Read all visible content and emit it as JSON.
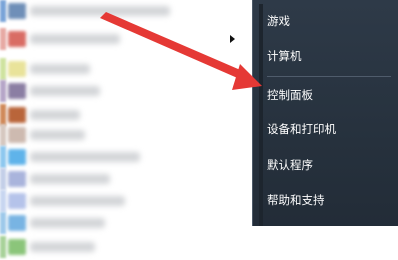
{
  "right_menu": {
    "items": [
      {
        "label": "游戏"
      },
      {
        "label": "计算机"
      },
      {
        "label": "控制面板"
      },
      {
        "label": "设备和打印机"
      },
      {
        "label": "默认程序"
      },
      {
        "label": "帮助和支持"
      }
    ]
  },
  "colors": {
    "menu_bg": "#2a3542",
    "menu_text": "#ffffff",
    "annotation_arrow": "#e53935"
  }
}
